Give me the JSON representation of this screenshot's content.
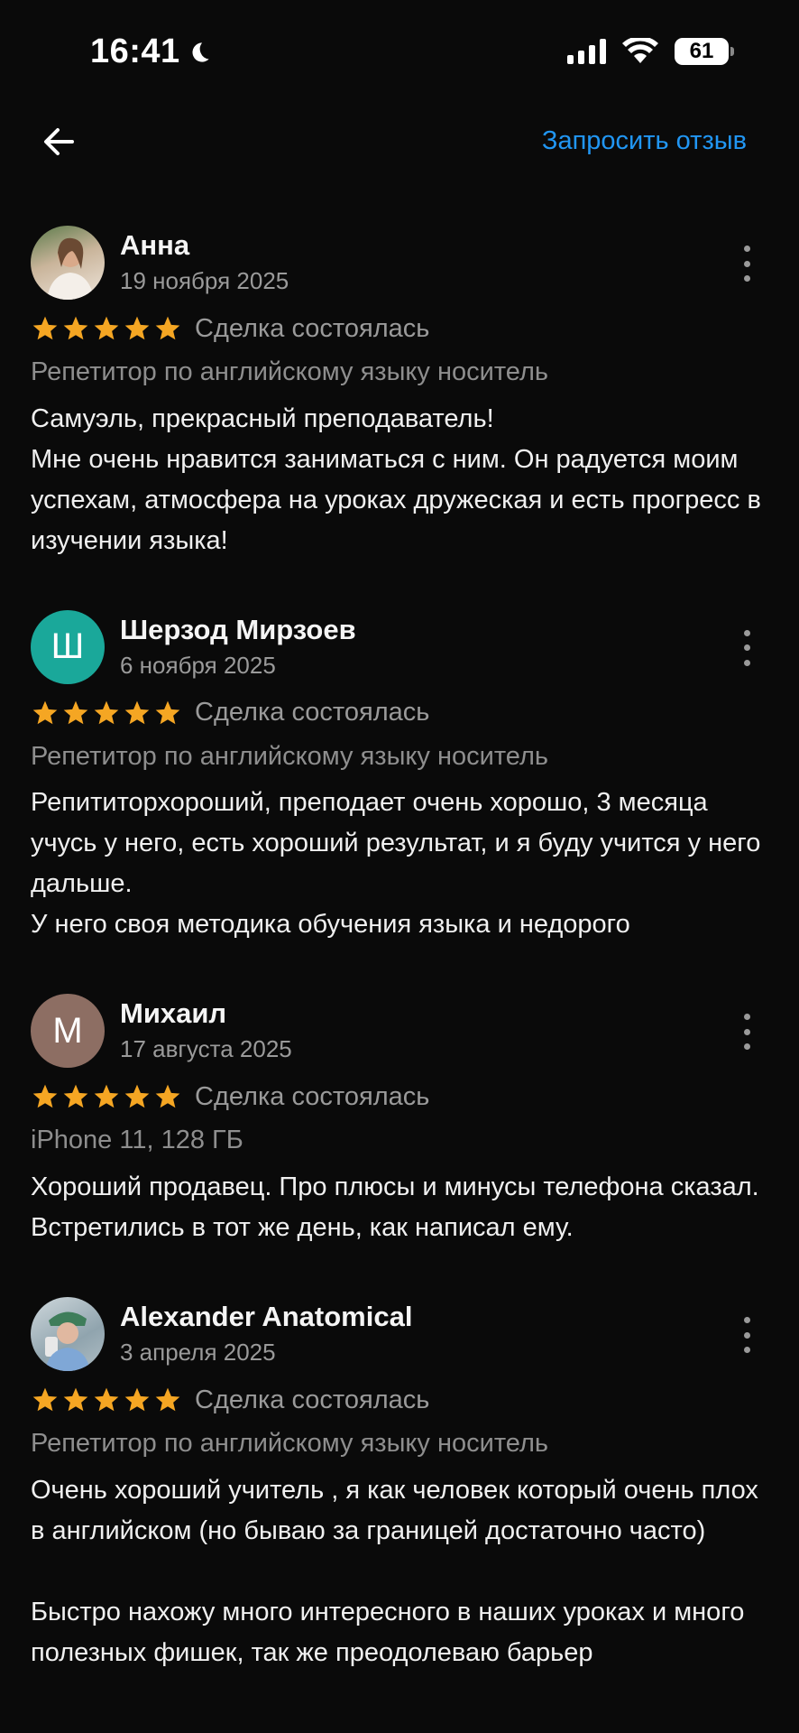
{
  "status_bar": {
    "time": "16:41",
    "battery": "61"
  },
  "header": {
    "request_review": "Запросить отзыв"
  },
  "colors": {
    "accent": "#2196f3",
    "star": "#f5a623"
  },
  "reviews": [
    {
      "name": "Анна",
      "date": "19 ноября 2025",
      "avatar_type": "photo",
      "avatar_letter": "",
      "rating": 5,
      "deal": "Сделка состоялась",
      "category": "Репетитор по английскому языку носитель",
      "text": "Самуэль, прекрасный преподаватель!\nМне очень нравится заниматься с ним. Он радуется моим успехам, атмосфера на уроках дружеская и есть прогресс в изучении языка!"
    },
    {
      "name": "Шерзод Мирзоев",
      "date": "6 ноября 2025",
      "avatar_type": "letter",
      "avatar_letter": "Ш",
      "avatar_color": "#1aa89a",
      "rating": 5,
      "deal": "Сделка состоялась",
      "category": "Репетитор по английскому языку носитель",
      "text": "Репититорхороший, преподает очень хорошо, 3 месяца учусь у него, есть хороший результат, и я буду учится у него дальше.\nУ него своя методика обучения языка и недорого"
    },
    {
      "name": "Михаил",
      "date": "17 августа 2025",
      "avatar_type": "letter",
      "avatar_letter": "М",
      "avatar_color": "#8d6e63",
      "rating": 5,
      "deal": "Сделка состоялась",
      "category": "iPhone 11, 128 ГБ",
      "text": "Хороший продавец. Про плюсы и минусы телефона сказал. Встретились в тот же день, как написал ему."
    },
    {
      "name": "Alexander Anatomical",
      "date": "3 апреля 2025",
      "avatar_type": "photo",
      "avatar_letter": "",
      "rating": 5,
      "deal": "Сделка состоялась",
      "category": "Репетитор по английскому языку носитель",
      "text": "Очень хороший учитель , я как человек который очень плох в английском (но бываю за границей достаточно часто)\n\nБыстро нахожу много интересного в наших уроках и много полезных фишек, так же преодолеваю барьер"
    }
  ]
}
